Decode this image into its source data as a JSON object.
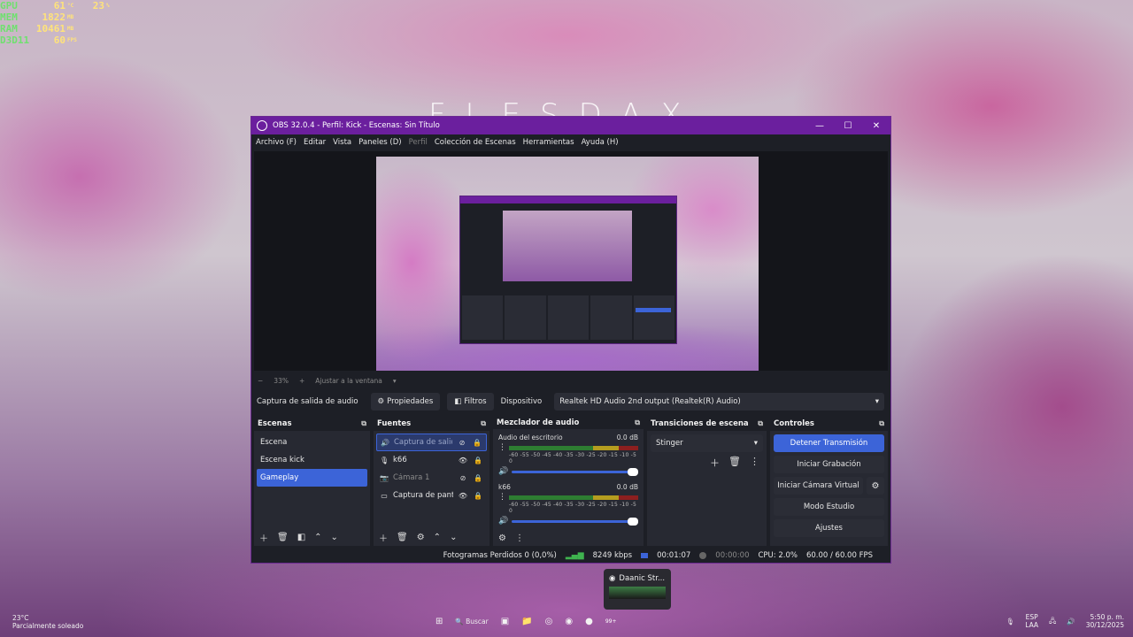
{
  "overlay_stats": [
    {
      "name": "GPU",
      "v1": "61",
      "u1": "°C",
      "v2": "23",
      "u2": "%"
    },
    {
      "name": "MEM",
      "v1": "1822",
      "u1": "MB",
      "v2": "",
      "u2": ""
    },
    {
      "name": "RAM",
      "v1": "10461",
      "u1": "MB",
      "v2": "",
      "u2": ""
    },
    {
      "name": "D3D11",
      "v1": "60",
      "u1": "FPS",
      "v2": "",
      "u2": ""
    }
  ],
  "wallpaper_logo": "FLESDAX",
  "window": {
    "title": "OBS 32.0.4 - Perfil: Kick - Escenas: Sin Título",
    "minimize": "—",
    "maximize": "☐",
    "close": "✕"
  },
  "menu": {
    "items": [
      {
        "label": "Archivo (F)",
        "enabled": true
      },
      {
        "label": "Editar",
        "enabled": true
      },
      {
        "label": "Vista",
        "enabled": true
      },
      {
        "label": "Paneles (D)",
        "enabled": true
      },
      {
        "label": "Perfil",
        "enabled": false
      },
      {
        "label": "Colección de Escenas",
        "enabled": true
      },
      {
        "label": "Herramientas",
        "enabled": true
      },
      {
        "label": "Ayuda (H)",
        "enabled": true
      }
    ]
  },
  "zoom": {
    "minus": "−",
    "level": "33%",
    "plus": "+",
    "fit": "Ajustar a la ventana",
    "dropdown": "▾"
  },
  "source_bar": {
    "source_name": "Captura de salida de audio",
    "properties": "Propiedades",
    "filters": "Filtros",
    "device_label": "Dispositivo",
    "device_value": "Realtek HD Audio 2nd output (Realtek(R) Audio)"
  },
  "scenes": {
    "title": "Escenas",
    "items": [
      "Escena",
      "Escena kick",
      "Gameplay"
    ],
    "active_index": 2
  },
  "sources": {
    "title": "Fuentes",
    "items": [
      {
        "icon": "🔊",
        "label": "Captura de salida",
        "visible": false
      },
      {
        "icon": "🎙",
        "label": "k66",
        "visible": true
      },
      {
        "icon": "📷",
        "label": "Cámara 1",
        "visible": false
      },
      {
        "icon": "▭",
        "label": "Captura de panta",
        "visible": true
      }
    ]
  },
  "mixer": {
    "title": "Mezclador de audio",
    "channels": [
      {
        "name": "Audio del escritorio",
        "db": "0.0 dB",
        "scale": "-60 -55 -50 -45 -40 -35 -30 -25 -20 -15 -10 -5 0",
        "volume_fraction": 1.0
      },
      {
        "name": "k66",
        "db": "0.0 dB",
        "scale": "-60 -55 -50 -45 -40 -35 -30 -25 -20 -15 -10 -5 0",
        "volume_fraction": 1.0
      }
    ]
  },
  "transitions": {
    "title": "Transiciones de escena",
    "selected": "Stinger"
  },
  "controls": {
    "title": "Controles",
    "stop_stream": "Detener Transmisión",
    "start_recording": "Iniciar Grabación",
    "start_virtual_cam": "Iniciar Cámara Virtual",
    "studio_mode": "Modo Estudio",
    "settings": "Ajustes"
  },
  "status": {
    "dropped": "Fotogramas Perdidos 0 (0,0%)",
    "bitrate": "8249 kbps",
    "live_time": "00:01:07",
    "rec_time": "00:00:00",
    "cpu": "CPU: 2.0%",
    "fps": "60.00 / 60.00 FPS"
  },
  "thumbnail": {
    "label": "Daanic Str..."
  },
  "taskbar": {
    "temperature": "23°C",
    "weather": "Parcialmente soleado",
    "search": "Buscar",
    "badge": "99+",
    "lang": "ESP",
    "layout": "LAA",
    "time": "5:50 p. m.",
    "date": "30/12/2025"
  },
  "colors": {
    "title_bar": "#6b1f9e",
    "accent": "#3c64d8",
    "panel": "#272932",
    "window_bg": "#1d1f26"
  }
}
